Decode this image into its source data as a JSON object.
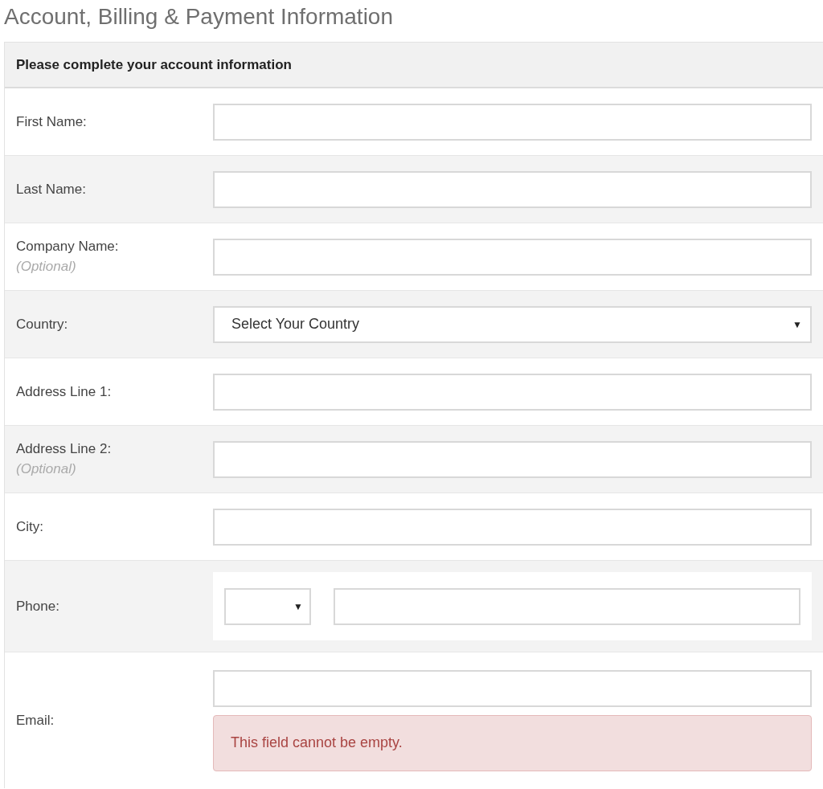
{
  "page_title": "Account, Billing & Payment Information",
  "form": {
    "heading": "Please complete your account information",
    "rows": [
      {
        "kind": "text",
        "label": "First Name:"
      },
      {
        "kind": "text",
        "label": "Last Name:"
      },
      {
        "kind": "text",
        "label": "Company Name:",
        "note": "(Optional)"
      },
      {
        "kind": "select",
        "label": "Country:",
        "value": "Select Your Country",
        "caret": "▼"
      },
      {
        "kind": "text",
        "label": "Address Line 1:"
      },
      {
        "kind": "text",
        "label": "Address Line 2:",
        "note": "(Optional)"
      },
      {
        "kind": "text",
        "label": "City:"
      },
      {
        "kind": "phone",
        "label": "Phone:",
        "caret": "▼"
      },
      {
        "kind": "text",
        "label": "Email:",
        "error": "This field cannot be empty."
      }
    ]
  }
}
